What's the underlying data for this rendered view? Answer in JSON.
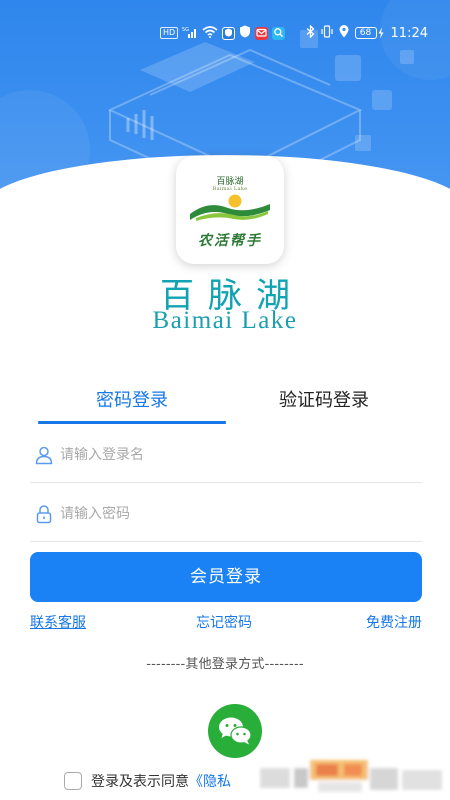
{
  "status_bar": {
    "left_chips": [
      "HD",
      "5G"
    ],
    "time": "11:24",
    "battery": "68"
  },
  "logo": {
    "mini_title": "百脉湖",
    "mini_subtitle": "Baimai Lake",
    "slogan": "农活帮手"
  },
  "brand": {
    "title": "百脉湖",
    "subtitle": "Baimai Lake"
  },
  "tabs": [
    {
      "label": "密码登录",
      "active": true
    },
    {
      "label": "验证码登录",
      "active": false
    }
  ],
  "form": {
    "username_placeholder": "请输入登录名",
    "password_placeholder": "请输入密码",
    "login_button": "会员登录"
  },
  "links": {
    "customer_service": "联系客服",
    "forgot_password": "忘记密码",
    "register": "免费注册"
  },
  "other_login": {
    "divider_text": "--------其他登录方式--------",
    "wechat_icon": "wechat-icon"
  },
  "agreement": {
    "prefix": "登录及表示同意",
    "link": "《隐私"
  },
  "colors": {
    "primary": "#1677e8",
    "button": "#1a82f5",
    "brand_teal": "#12a3b3",
    "wechat_green": "#2aae3a",
    "hero_blue": "#2f86ec"
  }
}
